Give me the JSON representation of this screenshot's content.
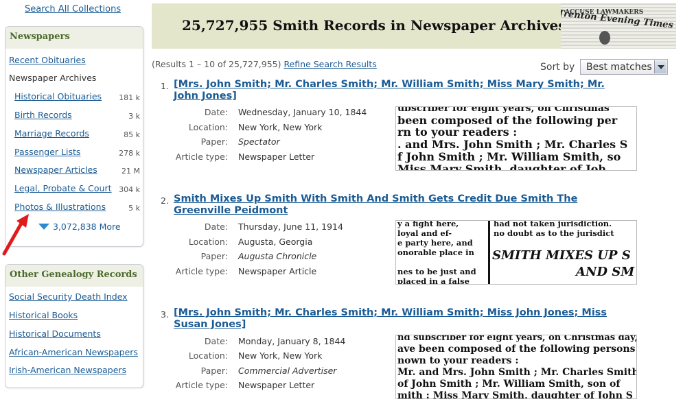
{
  "sidebar": {
    "search_all": "Search All Collections",
    "newspapers": {
      "heading": "Newspapers",
      "recent_obits": "Recent Obituaries",
      "archives": "Newspaper Archives",
      "items": [
        {
          "label": "Historical Obituaries",
          "count": "181 k"
        },
        {
          "label": "Birth Records",
          "count": "3 k"
        },
        {
          "label": "Marriage Records",
          "count": "85 k"
        },
        {
          "label": "Passenger Lists",
          "count": "278 k"
        },
        {
          "label": "Newspaper Articles",
          "count": "21 M"
        },
        {
          "label": "Legal, Probate & Court",
          "count": "304 k"
        },
        {
          "label": "Photos & Illustrations",
          "count": "5 k"
        }
      ],
      "more": "3,072,838 More"
    },
    "other": {
      "heading": "Other Genealogy Records",
      "items": [
        "Social Security Death Index",
        "Historical Books",
        "Historical Documents",
        "African-American Newspapers",
        "Irish-American Newspapers"
      ]
    }
  },
  "banner": {
    "title": "25,727,955 Smith Records in Newspaper Archives",
    "img_masthead": "Trenton Evening Times",
    "img_headline": "ACCUSE LAWMAKERS"
  },
  "results_bar": {
    "range_text": "(Results 1 – 10 of 25,727,955)",
    "refine": "Refine Search Results",
    "sort_label": "Sort by",
    "sort_value": "Best matches"
  },
  "labels": {
    "date": "Date:",
    "location": "Location:",
    "paper": "Paper:",
    "type": "Article type:"
  },
  "results": [
    {
      "num": "1.",
      "title": "[Mrs. John Smith; Mr. Charles Smith; Mr. William Smith; Miss Mary Smith; Mr. John Jones]",
      "date": "Wednesday, January 10, 1844",
      "location": "New York, New York",
      "paper": "Spectator",
      "type": "Newspaper Letter",
      "snippet": [
        "ubscriber for eight years, on Christmas",
        " been composed of the following per",
        "rn to your readers :",
        ". and Mrs. John Smith ; Mr. Charles S",
        "f John Smith ; Mr. William Smith, so",
        " Miss Mary Smith, daughter of Joh"
      ]
    },
    {
      "num": "2.",
      "title": "Smith Mixes Up Smith With Smith And Smith Gets Credit Due Smith The Greenville Peidmont",
      "date": "Thursday, June 11, 1914",
      "location": "Augusta, Georgia",
      "paper": "Augusta Chronicle",
      "type": "Newspaper Article",
      "snippet_left": [
        "y a fight here,",
        "loyal and ef-",
        "e party here, and",
        "onorable place in",
        "",
        "nes to be just and",
        "placed in a false"
      ],
      "snippet_right": [
        "had not taken jurisdiction.",
        "no doubt as to the jurisdict",
        "SMITH MIXES UP S",
        "AND SM"
      ]
    },
    {
      "num": "3.",
      "title": "[Mrs. John Smith; Mr. Charles Smith; Mr. William Smith; Miss John Jones; Miss Susan Jones]",
      "date": "Monday, January 8, 1844",
      "location": "New York, New York",
      "paper": "Commercial Advertiser",
      "type": "Newspaper Letter",
      "snippet": [
        "nd subscriber for eight years, on Christmas day,",
        "ave been composed of the following persons",
        "nown to your readers :",
        " Mr. and Mrs. John Smith ; Mr. Charles Smith",
        "of John Smith ; Mr. William Smith, son of",
        "mith : Miss Mary Smith, daughter of John S"
      ]
    }
  ],
  "colors": {
    "link": "#1b5b94",
    "panel_heading": "#4b6a2a",
    "banner_bg": "#e4e6cc",
    "arrow": "#e01b1b"
  }
}
